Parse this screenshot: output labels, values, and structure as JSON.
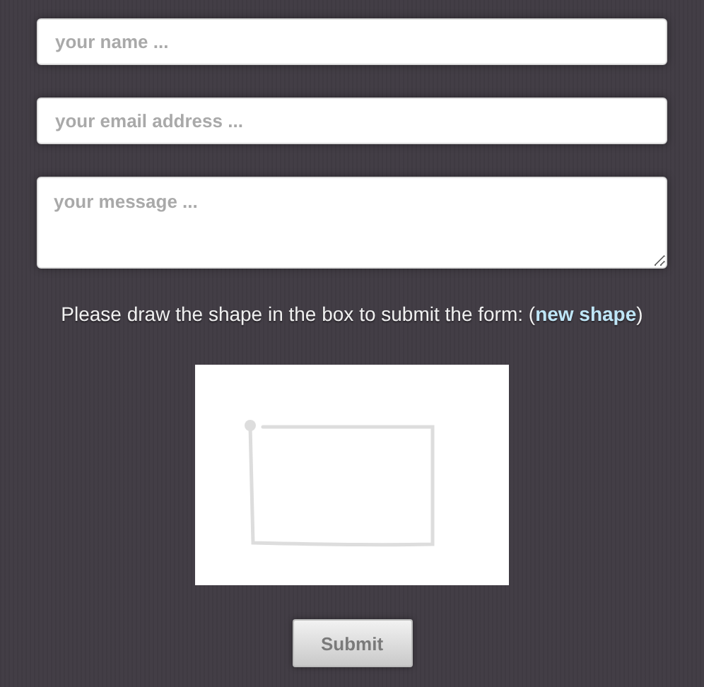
{
  "fields": [
    {
      "kind": "input",
      "placeholder": "your name ..."
    },
    {
      "kind": "input",
      "placeholder": "your email address ..."
    },
    {
      "kind": "textarea",
      "placeholder": "your message ..."
    }
  ],
  "prompt": {
    "before": "Please draw the shape in the box to submit the form: (",
    "link": "new shape",
    "after": ")"
  },
  "submit": "Submit"
}
